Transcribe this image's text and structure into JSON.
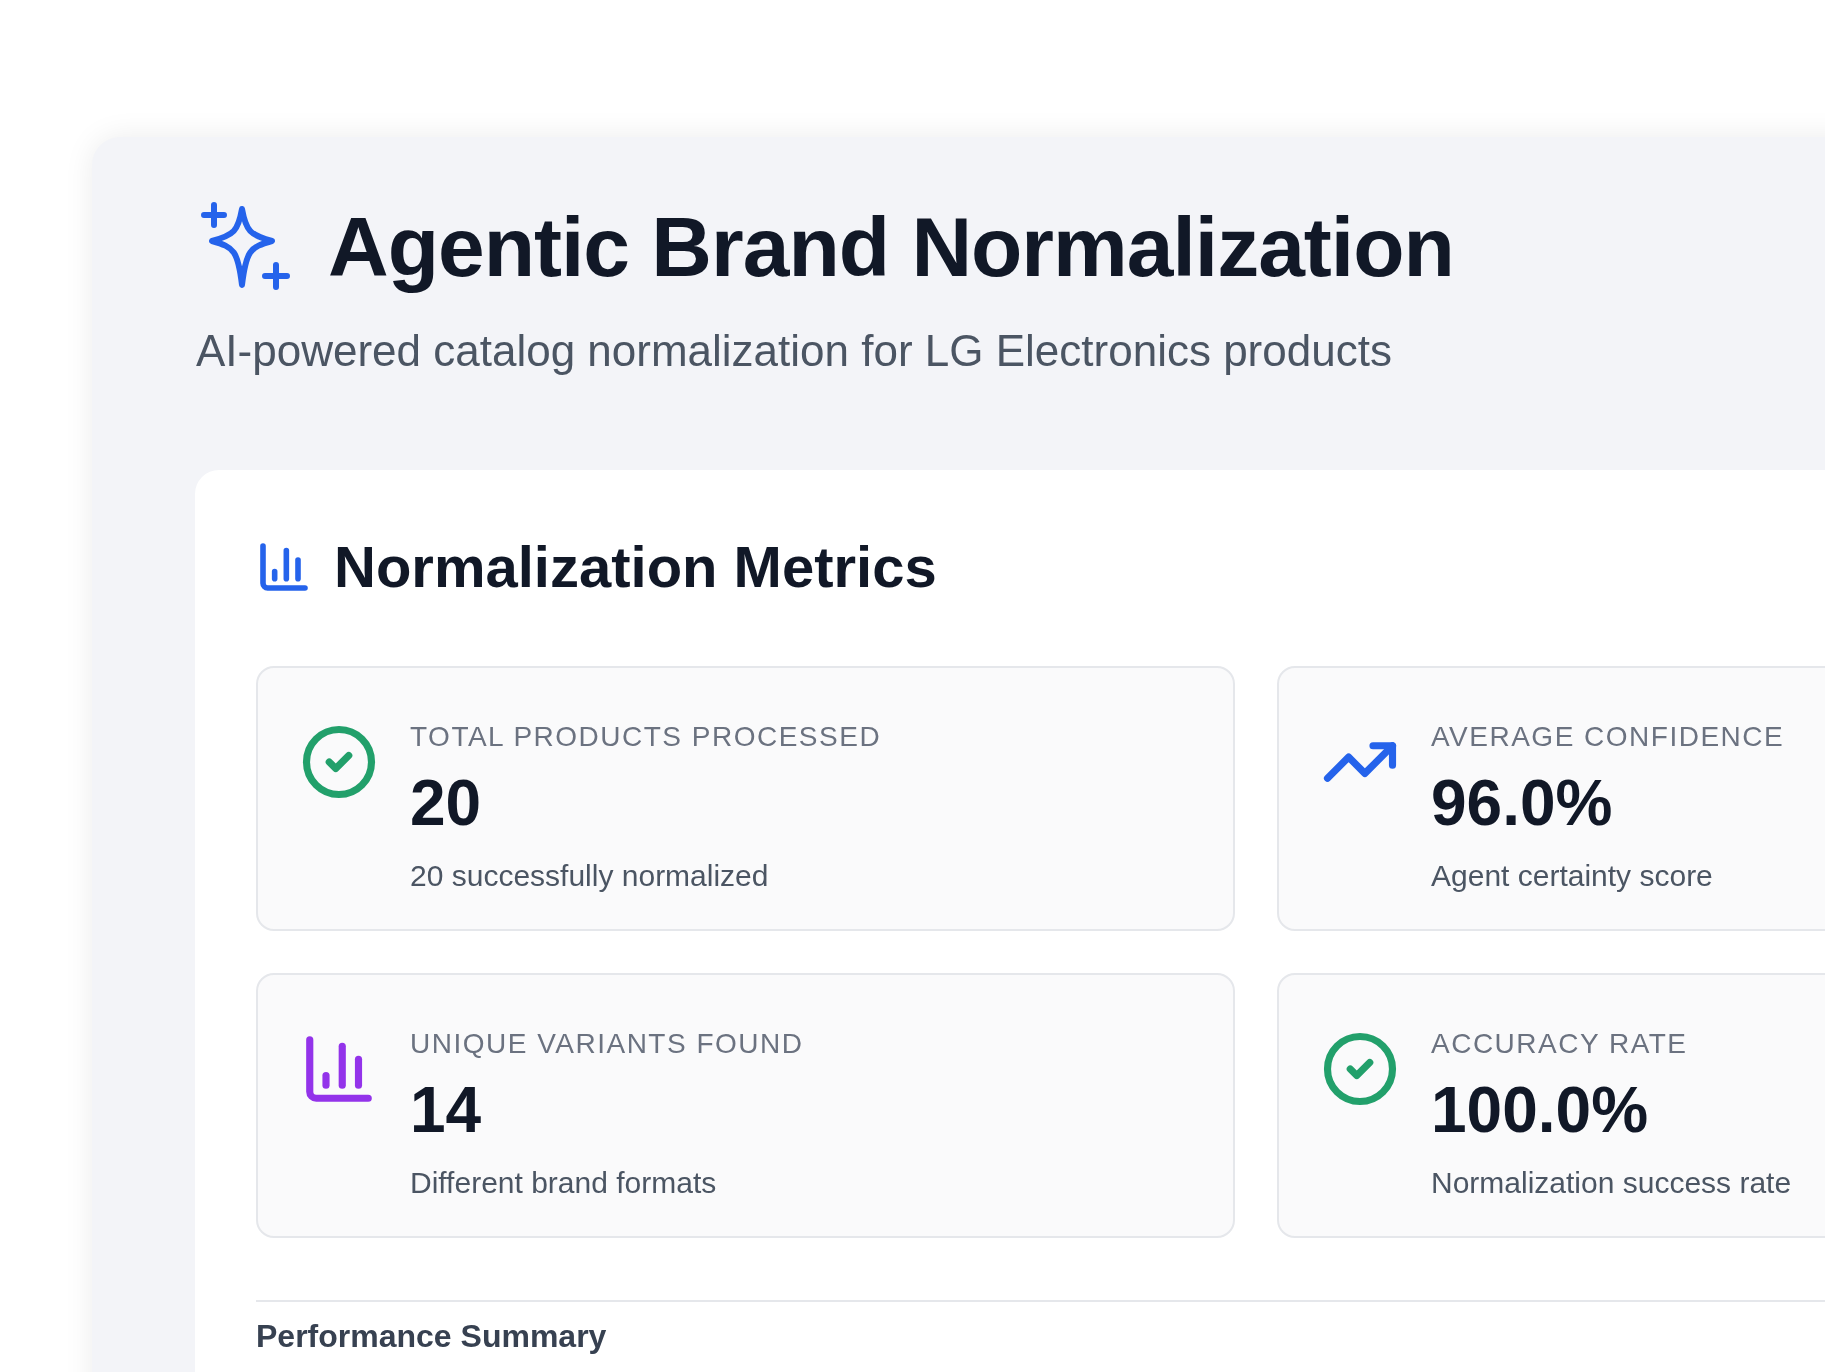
{
  "header": {
    "title": "Agentic Brand Normalization",
    "subtitle": "AI-powered catalog normalization for LG Electronics products"
  },
  "metrics": {
    "title": "Normalization Metrics",
    "cards": [
      {
        "kind": "check",
        "color": "#22a06b",
        "label": "TOTAL PRODUCTS PROCESSED",
        "value": "20",
        "description": "20 successfully normalized"
      },
      {
        "kind": "trend",
        "color": "#2563eb",
        "label": "AVERAGE CONFIDENCE",
        "value": "96.0%",
        "description": "Agent certainty score"
      },
      {
        "kind": "bars",
        "color": "#9333ea",
        "label": "UNIQUE VARIANTS FOUND",
        "value": "14",
        "description": "Different brand formats"
      },
      {
        "kind": "check",
        "color": "#22a06b",
        "label": "ACCURACY RATE",
        "value": "100.0%",
        "description": "Normalization success rate"
      }
    ]
  },
  "summary": {
    "title": "Performance Summary"
  }
}
